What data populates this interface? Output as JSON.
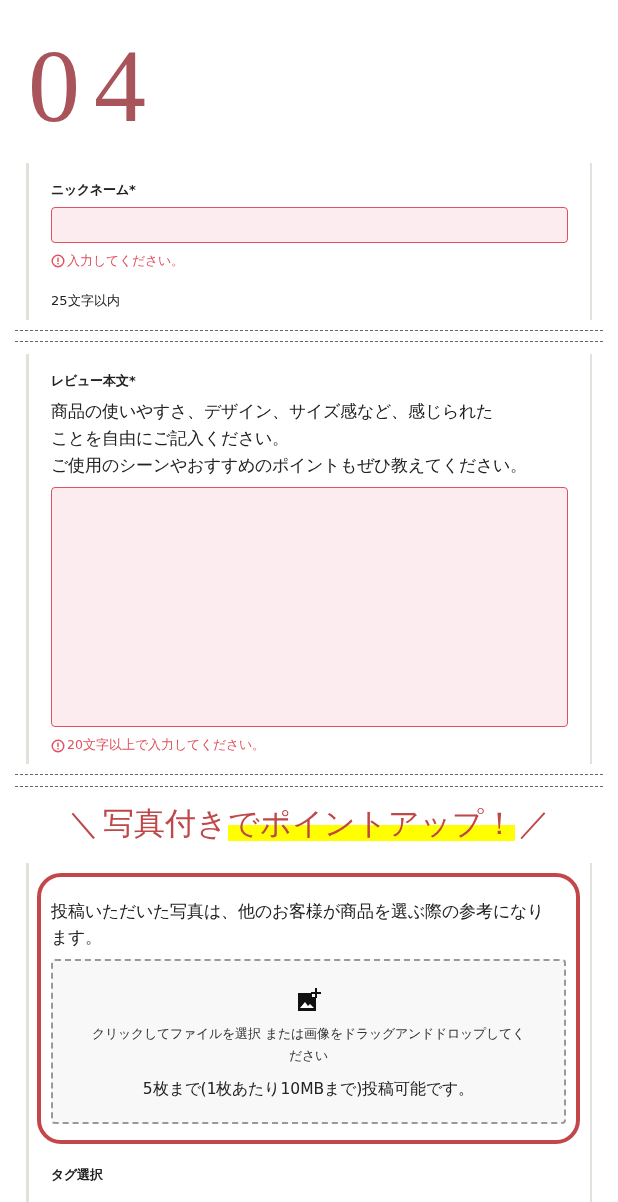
{
  "step_number": "04",
  "nickname": {
    "label": "ニックネーム*",
    "invalid": true,
    "error": "入力してください。",
    "note": "25文字以内"
  },
  "review": {
    "label": "レビュー本文*",
    "description": [
      "商品の使いやすさ、デザイン、サイズ感など、感じられたことを自由にご記入ください。",
      "ご使用のシーンやおすすめのポイントもぜひ教えてください。"
    ],
    "invalid": true,
    "error": "20文字以上で入力してください。"
  },
  "banner": {
    "left_mark": "＼",
    "text": "写真付き",
    "highlighted": "でポイントアップ！",
    "right_mark": "／"
  },
  "photo": {
    "description": "投稿いただいた写真は、他のお客様が商品を選ぶ際の参考になります。",
    "dropzone_text": "クリックしてファイルを選択 または画像をドラッグアンドドロップしてください",
    "limit": "5枚まで(1枚あたり10MBまで)投稿可能です。"
  },
  "tags": {
    "label": "タグ選択"
  }
}
